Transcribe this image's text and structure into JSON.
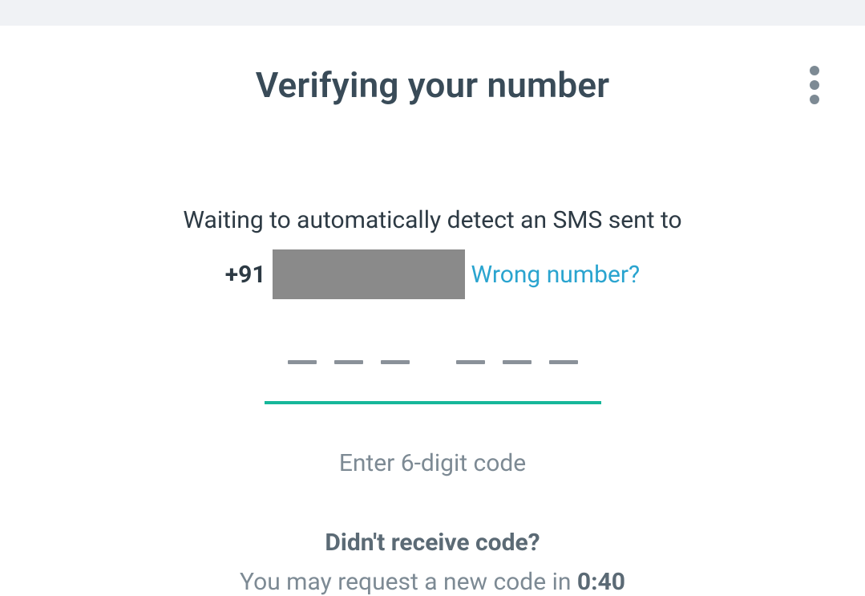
{
  "header": {
    "title": "Verifying your number"
  },
  "message": {
    "waiting_text": "Waiting to automatically detect an SMS sent to",
    "country_code": "+91",
    "wrong_number_label": "Wrong number?"
  },
  "code_input": {
    "hint": "Enter 6-digit code"
  },
  "resend": {
    "no_code_label": "Didn't receive code?",
    "request_prefix": "You may request a new code in ",
    "countdown": "0:40"
  },
  "icons": {
    "more": "more-vert-icon"
  },
  "colors": {
    "accent": "#16b79a",
    "link": "#2aa4cf"
  }
}
